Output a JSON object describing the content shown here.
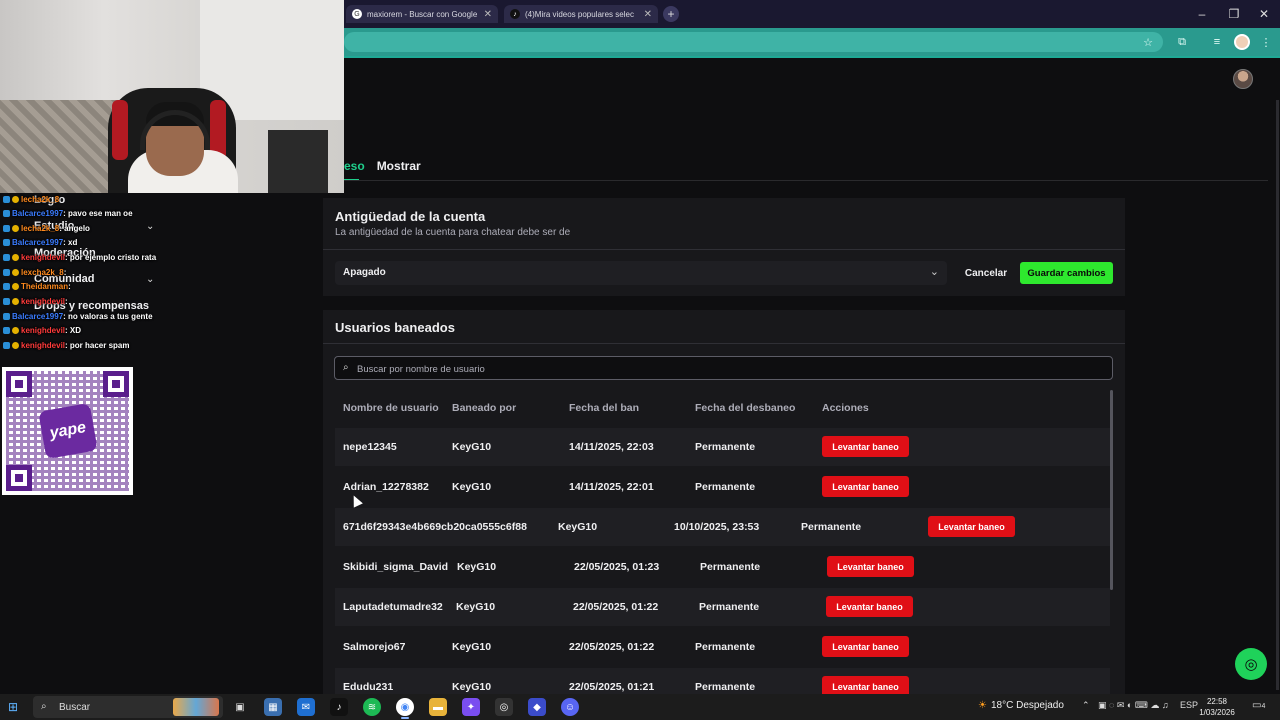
{
  "browser": {
    "tabs": [
      {
        "title": "maxiorem - Buscar con Google",
        "icon": "google-icon"
      },
      {
        "title": "(4)Mira videos populares selec",
        "icon": "tiktok-icon"
      }
    ]
  },
  "subnav": {
    "active": "eso",
    "item": "Mostrar"
  },
  "sidebar": {
    "items": [
      "Logro",
      "Estudio",
      "Moderación",
      "Comunidad",
      "Drops y recompensas"
    ]
  },
  "chat": [
    {
      "user": "lecha2k_8",
      "msg": "",
      "color": "orange"
    },
    {
      "user": "Balcarce1997",
      "msg": ": pavo ese man oe",
      "color": "blue"
    },
    {
      "user": "lecha2k_8",
      "msg": ": angelo",
      "color": "orange"
    },
    {
      "user": "Balcarce1997",
      "msg": ": xd",
      "color": "blue"
    },
    {
      "user": "kenighdevil",
      "msg": ": por ejemplo cristo rata",
      "color": "red"
    },
    {
      "user": "lexcha2k_8",
      "msg": ":",
      "color": "orange"
    },
    {
      "user": "Theidanman",
      "msg": ":",
      "color": "orange"
    },
    {
      "user": "kenighdevil",
      "msg": ":",
      "color": "red"
    },
    {
      "user": "Balcarce1997",
      "msg": ": no valoras a tus gente",
      "color": "blue"
    },
    {
      "user": "kenighdevil",
      "msg": ": XD",
      "color": "red"
    },
    {
      "user": "kenighdevil",
      "msg": ": por hacer spam",
      "color": "red"
    }
  ],
  "qr": {
    "logo": "yape"
  },
  "account_age": {
    "title": "Antigüedad de la cuenta",
    "description": "La antigüedad de la cuenta para chatear debe ser de",
    "select_value": "Apagado",
    "cancel": "Cancelar",
    "save": "Guardar cambios"
  },
  "banned": {
    "title": "Usuarios baneados",
    "search_placeholder": "Buscar por nombre de usuario",
    "headers": [
      "Nombre de usuario",
      "Baneado por",
      "Fecha del ban",
      "Fecha del desbaneo",
      "Acciones"
    ],
    "rows": [
      {
        "user": "nepe12345",
        "by": "KeyG10",
        "date": "14/11/2025, 22:03",
        "unban": "Permanente",
        "action": "Levantar baneo"
      },
      {
        "user": "Adrian_12278382",
        "by": "KeyG10",
        "date": "14/11/2025, 22:01",
        "unban": "Permanente",
        "action": "Levantar baneo"
      },
      {
        "user": "671d6f29343e4b669cb20ca0555c6f88",
        "by": "KeyG10",
        "date": "10/10/2025, 23:53",
        "unban": "Permanente",
        "action": "Levantar baneo"
      },
      {
        "user": "Skibidi_sigma_David",
        "by": "KeyG10",
        "date": "22/05/2025, 01:23",
        "unban": "Permanente",
        "action": "Levantar baneo"
      },
      {
        "user": "Laputadetumadre32",
        "by": "KeyG10",
        "date": "22/05/2025, 01:22",
        "unban": "Permanente",
        "action": "Levantar baneo"
      },
      {
        "user": "Salmorejo67",
        "by": "KeyG10",
        "date": "22/05/2025, 01:22",
        "unban": "Permanente",
        "action": "Levantar baneo"
      },
      {
        "user": "Edudu231",
        "by": "KeyG10",
        "date": "22/05/2025, 01:21",
        "unban": "Permanente",
        "action": "Levantar baneo"
      }
    ]
  },
  "taskbar": {
    "search": "Buscar",
    "weather": "18°C Despejado",
    "lang": "ESP",
    "time": "22:58",
    "date": "1/03/2026",
    "notif_count": "4"
  },
  "colors": {
    "accent": "#1fcf8c",
    "save": "#2ee82e",
    "unban": "#e00f16",
    "panel": "#18181b"
  }
}
